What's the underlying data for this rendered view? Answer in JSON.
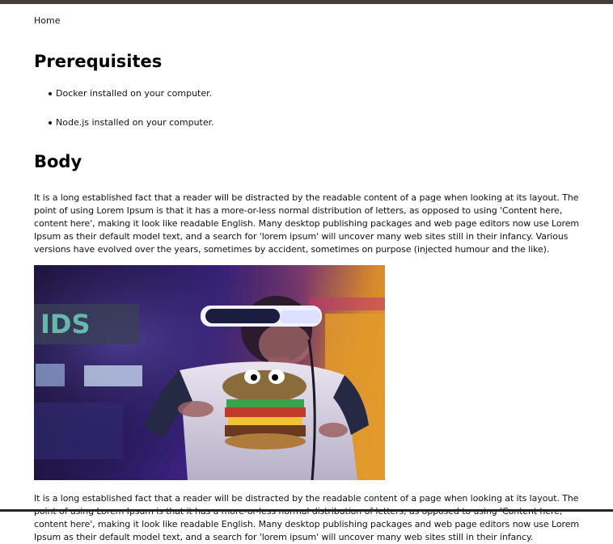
{
  "breadcrumb": {
    "home": "Home"
  },
  "sections": {
    "prerequisites": {
      "title": "Prerequisites",
      "items": [
        "Docker installed on your computer.",
        "Node.js installed on your computer."
      ]
    },
    "body": {
      "title": "Body",
      "paragraph": "It is a long established fact that a reader will be distracted by the readable content of a page when looking at its layout. The point of using Lorem Ipsum is that it has a more-or-less normal distribution of letters, as opposed to using 'Content here, content here', making it look like readable English. Many desktop publishing packages and web page editors now use Lorem Ipsum as their default model text, and a search for 'lorem ipsum' will uncover many web sites still in their infancy. Various versions have evolved over the years, sometimes by accident, sometimes on purpose (injected humour and the like).",
      "paragraph2": "It is a long established fact that a reader will be distracted by the readable content of a page when looking at its layout. The point of using Lorem Ipsum is that it has a more-or-less normal distribution of letters, as opposed to using 'Content here, content here', making it look like readable English. Many desktop publishing packages and web page editors now use Lorem Ipsum as their default model text, and a search for 'lorem ipsum' will uncover many web sites still in their infancy."
    }
  },
  "image": {
    "sign_text": "IDS"
  },
  "colors": {
    "topbar": "#433d3b",
    "text": "#111111",
    "heading": "#000000"
  }
}
